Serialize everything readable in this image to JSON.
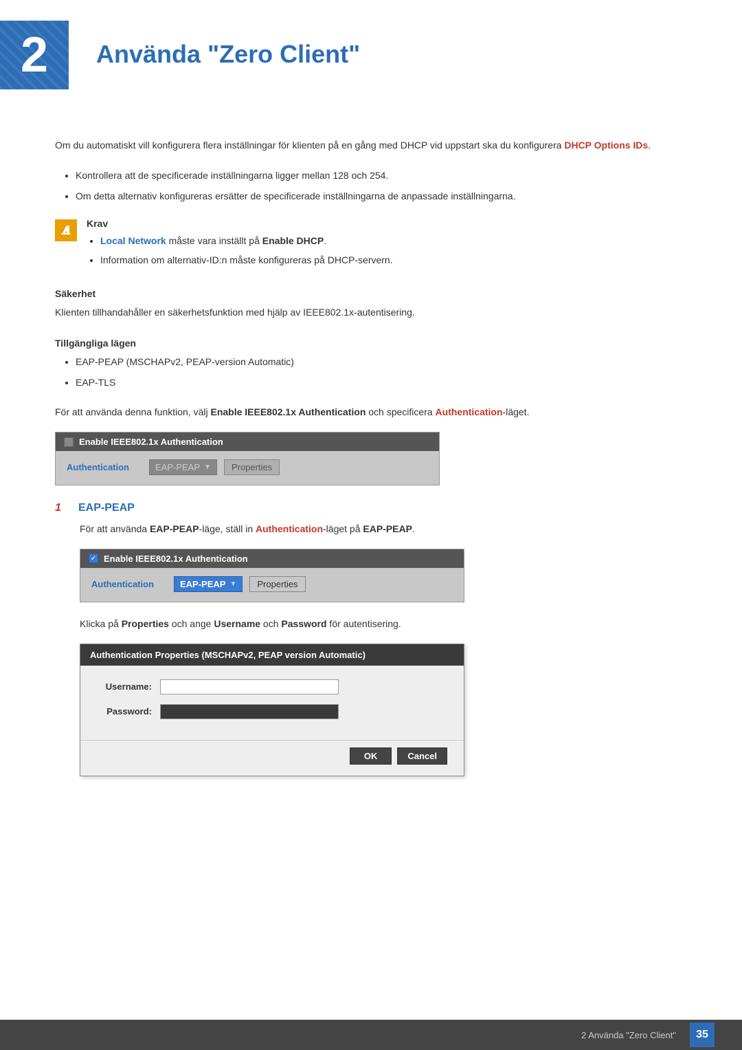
{
  "chapter": {
    "number": "2",
    "title": "Använda \"Zero Client\""
  },
  "intro": {
    "text": "Om du automatiskt vill konfigurera flera inställningar för klienten på en gång med DHCP vid uppstart ska du konfigurera ",
    "link_text": "DHCP Options IDs",
    "text_end": "."
  },
  "bullets_intro": [
    "Kontrollera att de specificerade inställningarna ligger mellan 128 och 254.",
    "Om detta alternativ konfigureras ersätter de specificerade inställningarna de anpassade inställningarna."
  ],
  "note": {
    "title": "Krav",
    "bullets": [
      {
        "prefix": "",
        "bold_part": "Local Network",
        "middle": " måste vara inställt på ",
        "bold_end": "Enable DHCP",
        "suffix": "."
      },
      {
        "prefix": "Information om alternativ-ID:n måste konfigureras på DHCP-servern.",
        "bold_part": "",
        "middle": "",
        "bold_end": "",
        "suffix": ""
      }
    ]
  },
  "security_section": {
    "heading": "Säkerhet",
    "text": "Klienten tillhandahåller en säkerhetsfunktion med hjälp av IEEE802.1x-autentisering."
  },
  "modes_section": {
    "heading": "Tillgängliga lägen",
    "bullets": [
      "EAP-PEAP (MSCHAPv2, PEAP-version Automatic)",
      "EAP-TLS"
    ]
  },
  "usage_text": {
    "prefix": "För att använda denna funktion, välj ",
    "bold1": "Enable IEEE802.1x Authentication",
    "middle": " och specificera ",
    "bold2": "Authentication",
    "suffix": "-läget."
  },
  "panel1": {
    "header": "Enable IEEE802.1x Authentication",
    "label": "Authentication",
    "dropdown": "EAP-PEAP",
    "button": "Properties"
  },
  "step1": {
    "number": "1",
    "title": "EAP-PEAP",
    "desc_prefix": "För att använda ",
    "bold1": "EAP-PEAP",
    "desc_middle": "-läge, ställ in ",
    "bold2": "Authentication",
    "desc_suffix2": "-läget på ",
    "bold3": "EAP-PEAP",
    "desc_end": "."
  },
  "panel2": {
    "header": "Enable IEEE802.1x Authentication",
    "label": "Authentication",
    "dropdown": "EAP-PEAP",
    "button": "Properties"
  },
  "properties_text": {
    "prefix": "Klicka på ",
    "bold1": "Properties",
    "middle": " och ange ",
    "bold2": "Username",
    "middle2": " och ",
    "bold3": "Password",
    "suffix": " för autentisering."
  },
  "auth_dialog": {
    "header": "Authentication Properties (MSCHAPv2, PEAP version Automatic)",
    "username_label": "Username:",
    "password_label": "Password:",
    "ok_button": "OK",
    "cancel_button": "Cancel"
  },
  "footer": {
    "text": "2 Använda \"Zero Client\"",
    "page": "35"
  }
}
